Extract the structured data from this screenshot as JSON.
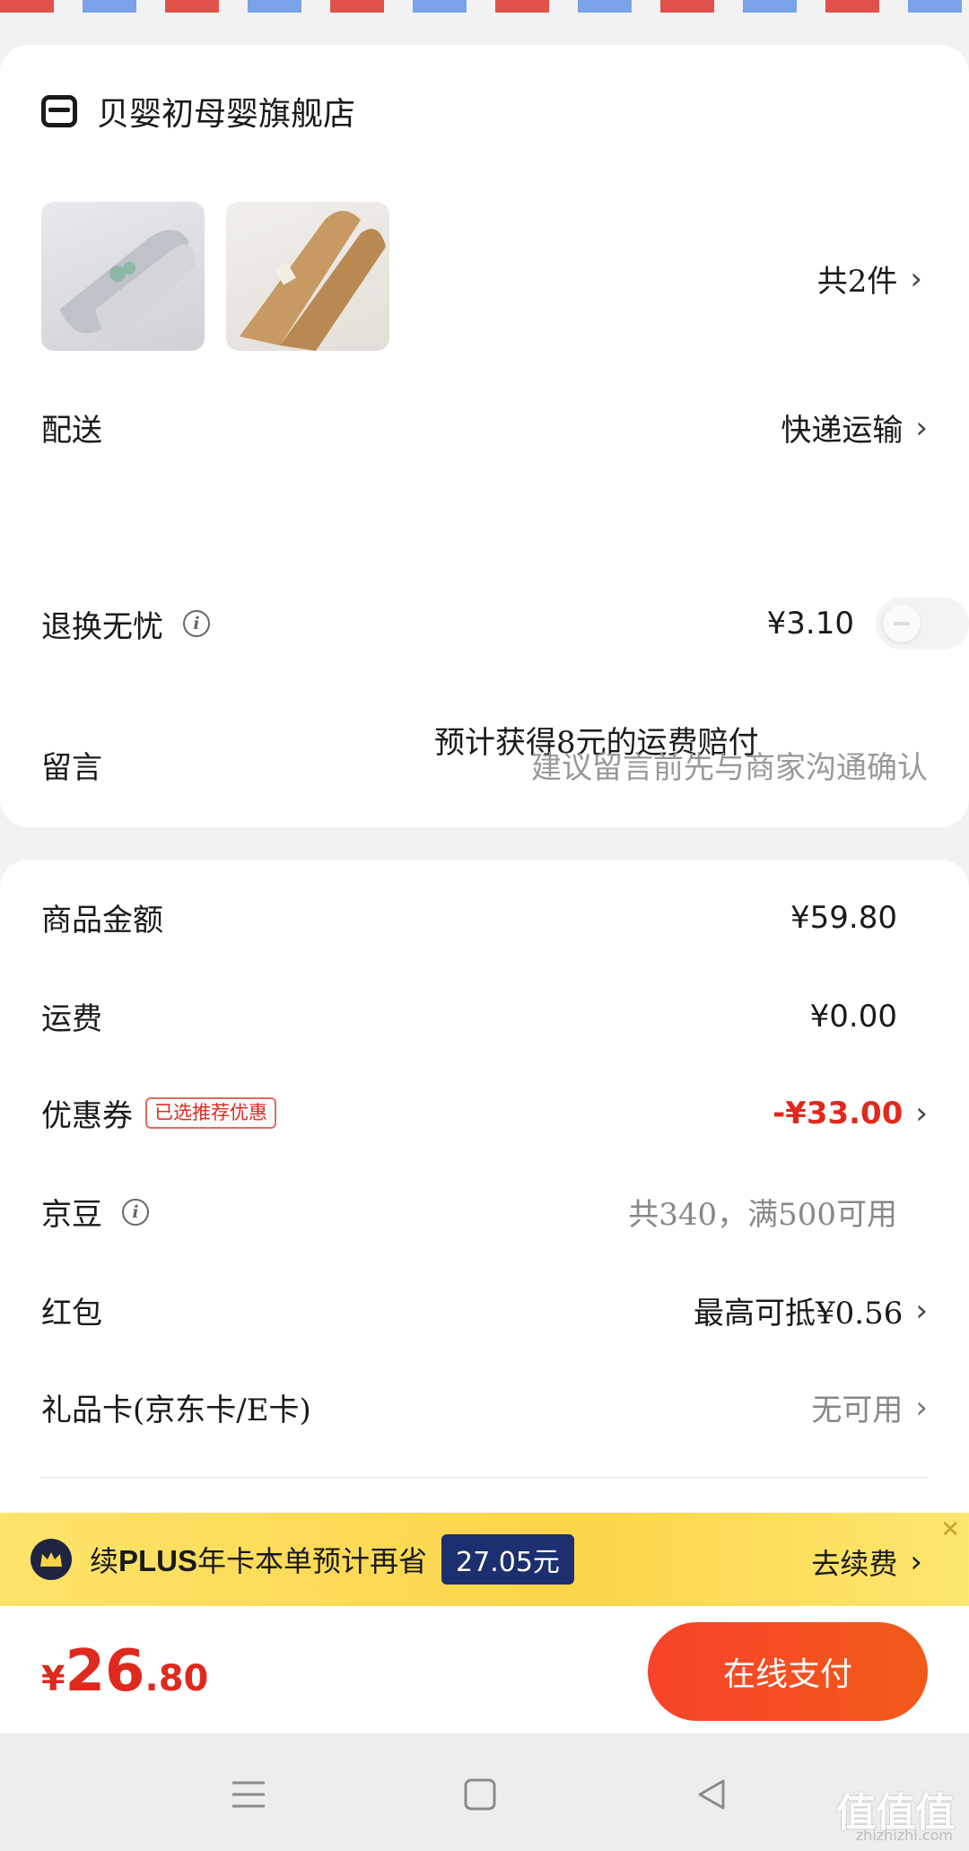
{
  "store": {
    "name": "贝婴初母婴旗舰店"
  },
  "products": {
    "count_label": "共2件",
    "chevron": "›"
  },
  "delivery": {
    "label": "配送",
    "value": "快递运输",
    "chevron": "›"
  },
  "return_insurance": {
    "label": "退换无忧",
    "info_icon": "i",
    "price": "¥3.10",
    "enabled": false,
    "hint": "预计获得8元的运费赔付"
  },
  "message": {
    "label": "留言",
    "placeholder": "建议留言前先与商家沟通确认"
  },
  "summary": {
    "goods_amount": {
      "label": "商品金额",
      "value": "¥59.80"
    },
    "shipping": {
      "label": "运费",
      "value": "¥0.00"
    },
    "coupon": {
      "label": "优惠券",
      "badge": "已选推荐优惠",
      "value": "-¥33.00",
      "chevron": "›"
    },
    "jd_beans": {
      "label": "京豆",
      "info_icon": "i",
      "value": "共340，满500可用"
    },
    "red_packet": {
      "label": "红包",
      "value": "最高可抵¥0.56",
      "chevron": "›"
    },
    "gift_card": {
      "label": "礼品卡(京东卡/E卡)",
      "value": "无可用",
      "chevron": "›"
    }
  },
  "plus_banner": {
    "prefix": "续",
    "brand": "PLUS",
    "text": "年卡本单预计再省",
    "amount": "27.05元",
    "renew": "去续费",
    "chevron": "›",
    "close": "✕"
  },
  "payment": {
    "currency": "¥",
    "total_int": "26",
    "total_dec": ".80",
    "button": "在线支付"
  },
  "watermark": {
    "main": "值值值",
    "sub": "zhizhizhi.com"
  },
  "colors": {
    "accent_red": "#e0291e",
    "plus_yellow": "#fbd54a",
    "plus_navy": "#1c2f6e"
  }
}
